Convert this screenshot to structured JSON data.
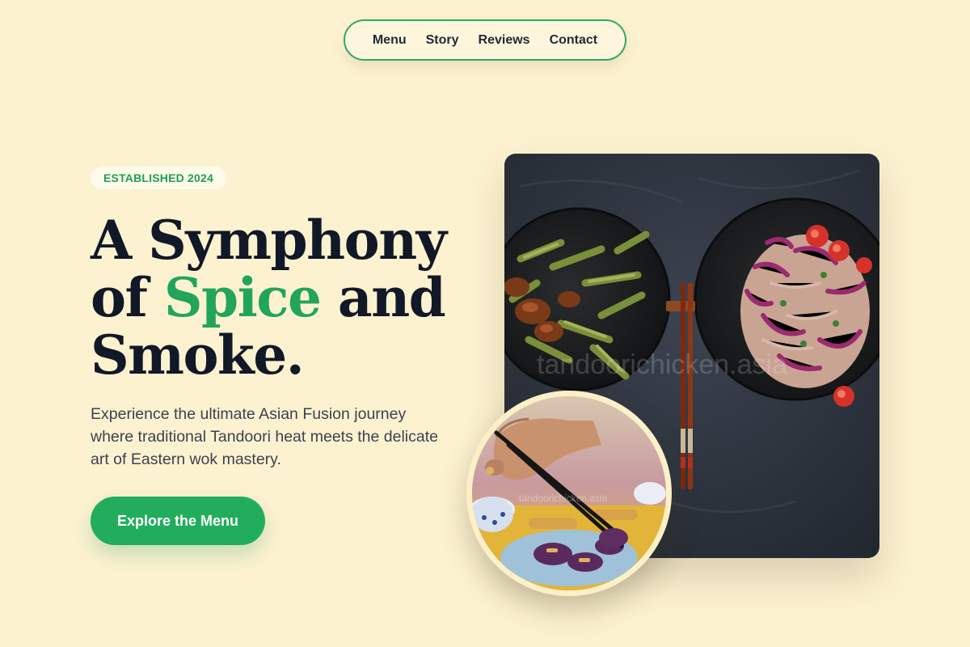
{
  "nav": {
    "items": [
      "Menu",
      "Story",
      "Reviews",
      "Contact"
    ]
  },
  "hero": {
    "badge": "ESTABLISHED 2024",
    "headline_line1": "A Symphony",
    "headline_of": "of ",
    "headline_accent": "Spice",
    "headline_and": " and",
    "headline_line3": "Smoke.",
    "intro": "Experience the ultimate Asian Fusion journey where traditional Tandoori heat meets the delicate art of Eastern wok mastery.",
    "cta_label": "Explore the Menu"
  },
  "images": {
    "main_watermark": "tandoorichicken.asia",
    "inset_watermark": "tandoorichicken.asia"
  },
  "colors": {
    "background": "#fdf2d0",
    "accent_green": "#22a55b",
    "heading": "#111827",
    "body_text": "#3b4250"
  }
}
